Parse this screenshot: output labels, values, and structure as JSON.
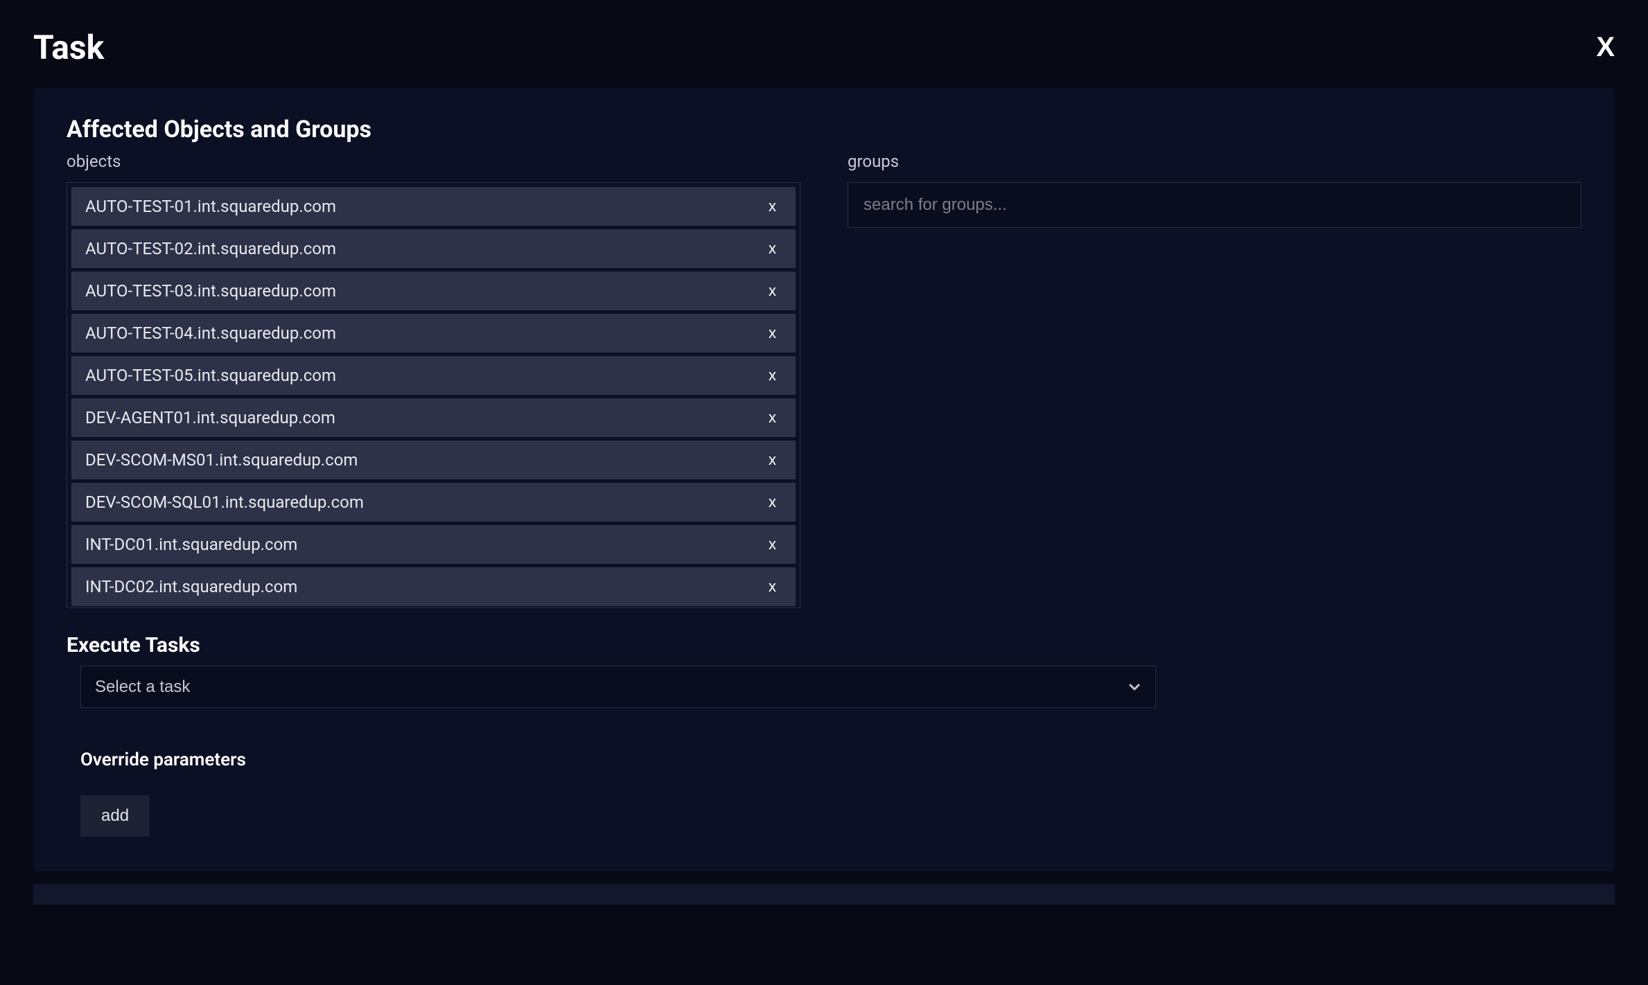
{
  "header": {
    "title": "Task",
    "close_label": "X"
  },
  "affected": {
    "title": "Affected Objects and Groups",
    "objects_label": "objects",
    "groups_label": "groups",
    "groups_placeholder": "search for groups...",
    "remove_label": "x",
    "objects": [
      "AUTO-TEST-01.int.squaredup.com",
      "AUTO-TEST-02.int.squaredup.com",
      "AUTO-TEST-03.int.squaredup.com",
      "AUTO-TEST-04.int.squaredup.com",
      "AUTO-TEST-05.int.squaredup.com",
      "DEV-AGENT01.int.squaredup.com",
      "DEV-SCOM-MS01.int.squaredup.com",
      "DEV-SCOM-SQL01.int.squaredup.com",
      "INT-DC01.int.squaredup.com",
      "INT-DC02.int.squaredup.com"
    ]
  },
  "execute": {
    "title": "Execute Tasks",
    "select_placeholder": "Select a task"
  },
  "override": {
    "title": "Override parameters",
    "add_label": "add"
  }
}
